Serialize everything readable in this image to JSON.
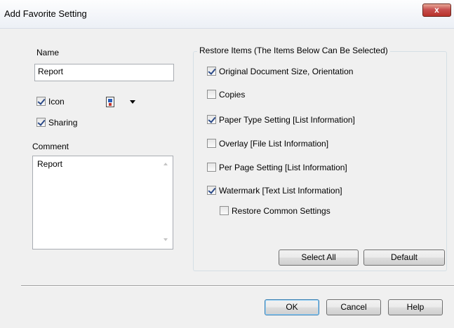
{
  "window": {
    "title": "Add Favorite Setting",
    "close_label": "x"
  },
  "name_section": {
    "label": "Name",
    "value": "Report"
  },
  "icon": {
    "label": "Icon",
    "checked": true,
    "selected_icon": "document-icon"
  },
  "sharing": {
    "label": "Sharing",
    "checked": true
  },
  "comment": {
    "label": "Comment",
    "value": "Report"
  },
  "restore": {
    "group_title": "Restore Items (The Items Below Can Be Selected)",
    "items": [
      {
        "label": "Original Document Size, Orientation",
        "checked": true
      },
      {
        "label": "Copies",
        "checked": false
      },
      {
        "label": "Paper Type Setting [List Information]",
        "checked": true
      },
      {
        "label": "Overlay [File List Information]",
        "checked": false
      },
      {
        "label": "Per Page Setting [List Information]",
        "checked": false
      },
      {
        "label": "Watermark [Text List Information]",
        "checked": true
      },
      {
        "label": "Restore Common Settings",
        "checked": false
      }
    ],
    "select_all_label": "Select All",
    "default_label": "Default"
  },
  "footer": {
    "ok_label": "OK",
    "cancel_label": "Cancel",
    "help_label": "Help"
  }
}
